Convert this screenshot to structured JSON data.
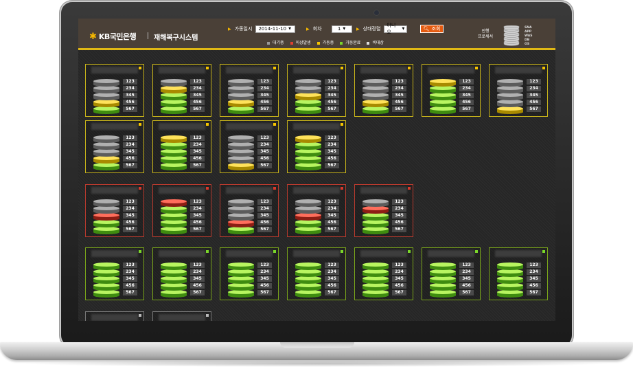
{
  "header": {
    "brand": "KB국민은행",
    "system_title": "재해복구시스템",
    "date_label": "가동일시",
    "date_value": "2014-11-10",
    "round_label": "회차",
    "round_value": "1",
    "status_label": "상태정렬",
    "status_value": "아니오",
    "search_label": "조회",
    "progress_label_line1": "진행",
    "progress_label_line2": "프로세서",
    "layers": [
      "SNA",
      "APP",
      "WAS",
      "DB",
      "OS"
    ]
  },
  "legend": [
    {
      "label": "대기중",
      "color": "#9a9a9a"
    },
    {
      "label": "이상발생",
      "color": "#e04030"
    },
    {
      "label": "가동중",
      "color": "#f5c400"
    },
    {
      "label": "가동완료",
      "color": "#7ad62a"
    },
    {
      "label": "비대상",
      "color": "#dddddd"
    }
  ],
  "colors": {
    "grey": "#8a8a8a",
    "yellow": "#f5c400",
    "green": "#7ad62a",
    "red": "#d8382a",
    "border_yellow": "#c8b41a",
    "border_red": "#b83a2e",
    "border_green": "#7aa61a",
    "border_grey": "#777777"
  },
  "layer_values": [
    "123",
    "234",
    "345",
    "456",
    "567"
  ],
  "cards": [
    {
      "group": "yellow",
      "title": "",
      "states": [
        "grey",
        "grey",
        "grey",
        "yellow",
        "green"
      ]
    },
    {
      "group": "yellow",
      "title": "",
      "states": [
        "grey",
        "yellow",
        "green",
        "green",
        "green"
      ]
    },
    {
      "group": "yellow",
      "title": "",
      "states": [
        "grey",
        "grey",
        "grey",
        "yellow",
        "green"
      ]
    },
    {
      "group": "yellow",
      "title": "",
      "states": [
        "grey",
        "grey",
        "yellow",
        "green",
        "green"
      ]
    },
    {
      "group": "yellow",
      "title": "",
      "states": [
        "grey",
        "grey",
        "grey",
        "yellow",
        "green"
      ]
    },
    {
      "group": "yellow",
      "title": "",
      "states": [
        "yellow",
        "green",
        "green",
        "green",
        "green"
      ]
    },
    {
      "group": "yellow",
      "title": "",
      "states": [
        "grey",
        "grey",
        "grey",
        "grey",
        "yellow"
      ]
    },
    {
      "group": "yellow",
      "title": "",
      "states": [
        "grey",
        "grey",
        "grey",
        "yellow",
        "green"
      ]
    },
    {
      "group": "yellow",
      "title": "",
      "states": [
        "yellow",
        "green",
        "green",
        "green",
        "green"
      ]
    },
    {
      "group": "yellow",
      "title": "",
      "states": [
        "grey",
        "grey",
        "grey",
        "grey",
        "yellow"
      ]
    },
    {
      "group": "yellow",
      "title": "",
      "states": [
        "yellow",
        "green",
        "green",
        "green",
        "green"
      ]
    },
    {
      "group": "red",
      "title": "",
      "states": [
        "grey",
        "grey",
        "red",
        "green",
        "green"
      ]
    },
    {
      "group": "red",
      "title": "",
      "states": [
        "red",
        "green",
        "green",
        "green",
        "green"
      ]
    },
    {
      "group": "red",
      "title": "",
      "states": [
        "grey",
        "grey",
        "grey",
        "red",
        "green"
      ]
    },
    {
      "group": "red",
      "title": "",
      "states": [
        "grey",
        "grey",
        "red",
        "green",
        "green"
      ]
    },
    {
      "group": "red",
      "title": "",
      "states": [
        "grey",
        "red",
        "green",
        "green",
        "green"
      ]
    },
    {
      "group": "green",
      "title": "",
      "states": [
        "green",
        "green",
        "green",
        "green",
        "green"
      ]
    },
    {
      "group": "green",
      "title": "",
      "states": [
        "green",
        "green",
        "green",
        "green",
        "green"
      ]
    },
    {
      "group": "green",
      "title": "",
      "states": [
        "green",
        "green",
        "green",
        "green",
        "green"
      ]
    },
    {
      "group": "green",
      "title": "",
      "states": [
        "green",
        "green",
        "green",
        "green",
        "green"
      ]
    },
    {
      "group": "green",
      "title": "",
      "states": [
        "green",
        "green",
        "green",
        "green",
        "green"
      ]
    },
    {
      "group": "green",
      "title": "",
      "states": [
        "green",
        "green",
        "green",
        "green",
        "green"
      ]
    },
    {
      "group": "green",
      "title": "",
      "states": [
        "green",
        "green",
        "green",
        "green",
        "green"
      ]
    },
    {
      "group": "grey",
      "title": "",
      "states": []
    },
    {
      "group": "grey",
      "title": "",
      "states": []
    }
  ]
}
